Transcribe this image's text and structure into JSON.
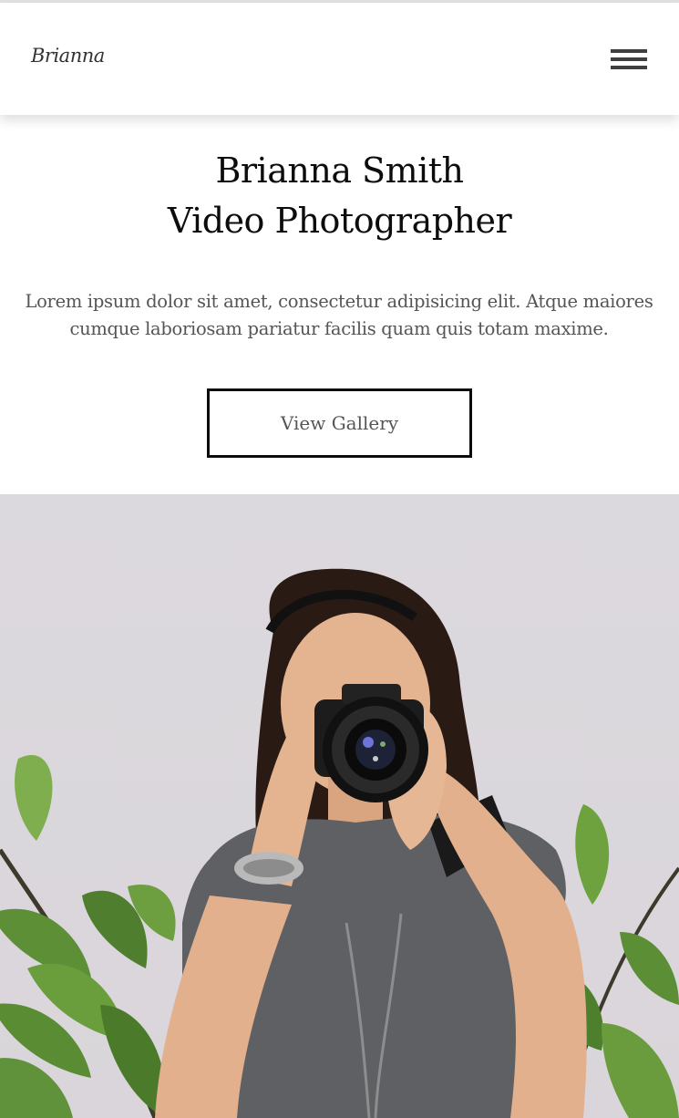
{
  "header": {
    "logo": "Brianna",
    "menu_icon": "hamburger-menu-icon"
  },
  "hero": {
    "title_line1": "Brianna Smith",
    "title_line2": "Video Photographer",
    "description": "Lorem ipsum dolor sit amet, consectetur adipisicing elit. Atque maiores cumque laboriosam pariatur facilis quam quis totam maxime.",
    "button_label": "View Gallery"
  },
  "colors": {
    "background": "#ffffff",
    "photo_background": "#dcd9de",
    "title": "#0c0c0c",
    "body_text": "#555555",
    "button_border": "#0b0b0b"
  }
}
